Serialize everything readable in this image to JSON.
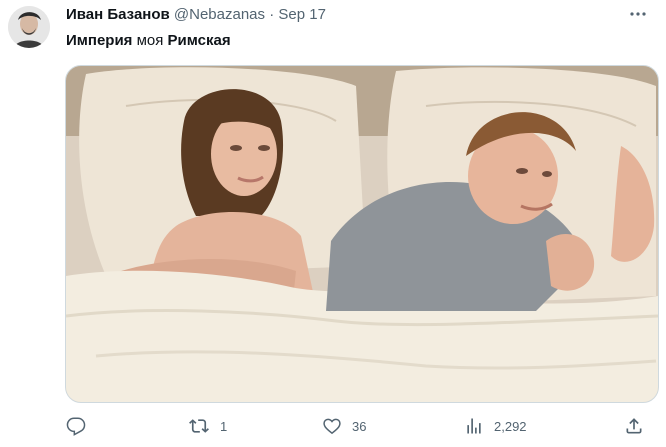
{
  "tweet": {
    "author_name": "Иван Базанов",
    "handle": "@Nebazanas",
    "separator": "·",
    "date": "Sep 17",
    "text_bold_1": "Империя",
    "text_regular": " моя ",
    "text_bold_2": "Римская"
  },
  "actions": {
    "reply_count": "",
    "retweet_count": "1",
    "like_count": "36",
    "views_count": "2,292"
  },
  "icons": {
    "avatar": "avatar",
    "more": "more-icon",
    "reply": "reply-icon",
    "retweet": "retweet-icon",
    "like": "heart-icon",
    "views": "views-icon",
    "share": "share-icon"
  },
  "colors": {
    "text_primary": "#0f1419",
    "text_secondary": "#536471",
    "border": "#cfd9de"
  }
}
